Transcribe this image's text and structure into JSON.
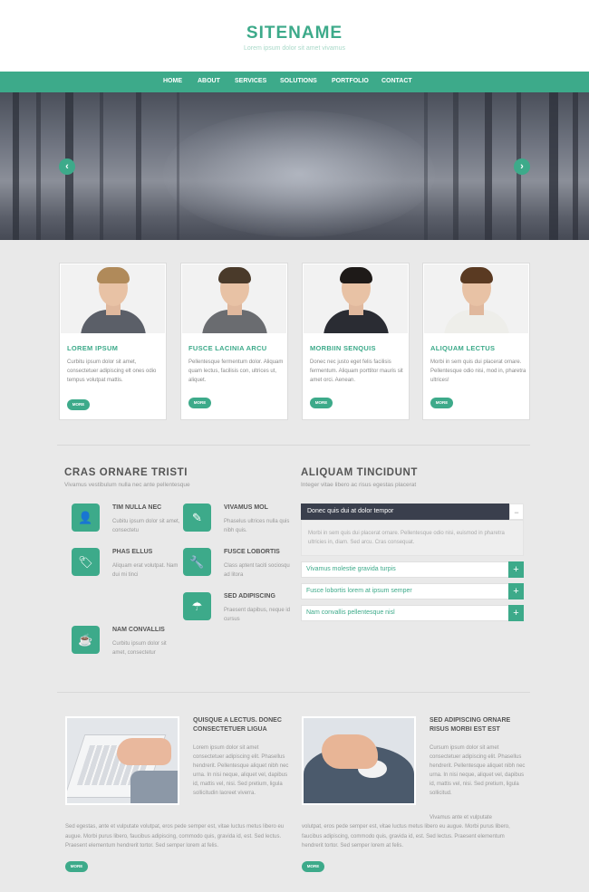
{
  "site": {
    "name": "SITENAME",
    "tagline": "Lorem ipsum dolor sit amet vivamus"
  },
  "nav": [
    "HOME",
    "ABOUT",
    "SERVICES",
    "SOLUTIONS",
    "PORTFOLIO",
    "CONTACT"
  ],
  "slider": {
    "prev": "‹",
    "next": "›"
  },
  "team": [
    {
      "title": "LOREM IPSUM",
      "text": "Curbitu ipsum dolor sit amet, consectetuer adipiscing elt ones odio tempus volutpat mattis.",
      "button": "MORE"
    },
    {
      "title": "FUSCE LACINIA ARCU",
      "text": "Pellentesque fermentum dolor. Aliquam quam lectus, facilisis con, ultrices ut, aliquet.",
      "button": "MORE"
    },
    {
      "title": "MORBIIN SENQUIS",
      "text": "Donec nec justo eget felis facilisis fermentum. Aliquam porttitor mauris sit amet orci. Aenean.",
      "button": "MORE"
    },
    {
      "title": "ALIQUAM LECTUS",
      "text": "Morbi in sem quis dui placerat ornare. Pellentesque odio nisi, mod in, pharetra ultrices!",
      "button": "MORE"
    }
  ],
  "features": {
    "title": "CRAS ORNARE TRISTI",
    "subtitle": "Vivamus vestibulum nulla nec ante pellentesque",
    "items": [
      {
        "icon": "user-icon",
        "glyph": "👤",
        "title": "TIM NULLA NEC",
        "text": "Cubitu ipsum dolor sit amet, consectetu"
      },
      {
        "icon": "pencil-icon",
        "glyph": "✎",
        "title": "VIVAMUS MOL",
        "text": "Phaselus ultrices nulla quis nibh quis."
      },
      {
        "icon": "tag-icon",
        "glyph": "🏷",
        "title": "PHAS ELLUS",
        "text": "Aliquam erat volutpat. Nam dui mi tinci"
      },
      {
        "icon": "wrench-icon",
        "glyph": "🔧",
        "title": "FUSCE LOBORTIS",
        "text": "Class aptent taciti sociosqu ad litora"
      },
      {
        "icon": "umbrella-icon",
        "glyph": "☂",
        "title": "SED ADIPISCING",
        "text": "Praesent dapibus, neque id cursus"
      },
      {
        "icon": "coffee-icon",
        "glyph": "☕",
        "title": "NAM CONVALLIS",
        "text": "Curbitu ipsum dolor sit amet, consectetur"
      }
    ]
  },
  "accordion": {
    "title": "ALIQUAM TINCIDUNT",
    "subtitle": "Integer vitae libero ac risus egestas placerat",
    "open": {
      "label": "Donec quis dui at dolor tempor",
      "toggle": "−",
      "body": "Morbi in sem quis dui placerat ornare. Pellentesque odio nisi, euismod in pharetra ultricies in, diam. Sed arcu. Cras consequat."
    },
    "items": [
      "Vivamus molestie gravida turpis",
      "Fusce lobortis lorem at ipsum semper",
      "Nam convallis pellentesque nisl"
    ],
    "plus": "+"
  },
  "blog": [
    {
      "title": "QUISQUE A LECTUS. DONEC CONSECTETUER LIGUA",
      "text": "Lorem ipsum dolor sit amet consectetuer adipiscing elit. Phasellus hendrerit. Pellentesque aliquet nibh nec urna. In nisi neque, aliquet vel, dapibus id, mattis vel, nisi. Sed pretium, ligula sollicitudin laoreet viverra.",
      "full": "Sed egestas, ante et vulputate volutpat, eros pede semper est, vitae luctus metus libero eu augue. Morbi purus libero, faucibus adipiscing, commodo quis, gravida id, est. Sed lectus. Praesent elementum hendrerit tortor. Sed semper lorem at felis.",
      "button": "MORE"
    },
    {
      "title": "SED ADIPISCING ORNARE RISUS MORBI EST EST",
      "text": "Cursum ipsum dolor sit amet consectetuer adipiscing elit. Phasellus hendrerit. Pellentesque aliquet nibh nec urna. In nisi neque, aliquet vel, dapibus id, mattis vel, nisi. Sed pretium, ligula sollicitud.",
      "text2": "Vivamus ante et vulputate",
      "full": "volutpat, eros pede semper est, vitae luctus metus libero eu augue. Morbi purus libero, faucibus adipiscing, commodo quis, gravida id, est. Sed lectus. Praesent elementum hendrerit tortor. Sed semper lorem at felis.",
      "button": "MORE"
    }
  ],
  "colors": {
    "accent": "#3daa8a",
    "dark": "#3a3f4d",
    "background": "#e9e9e9"
  }
}
